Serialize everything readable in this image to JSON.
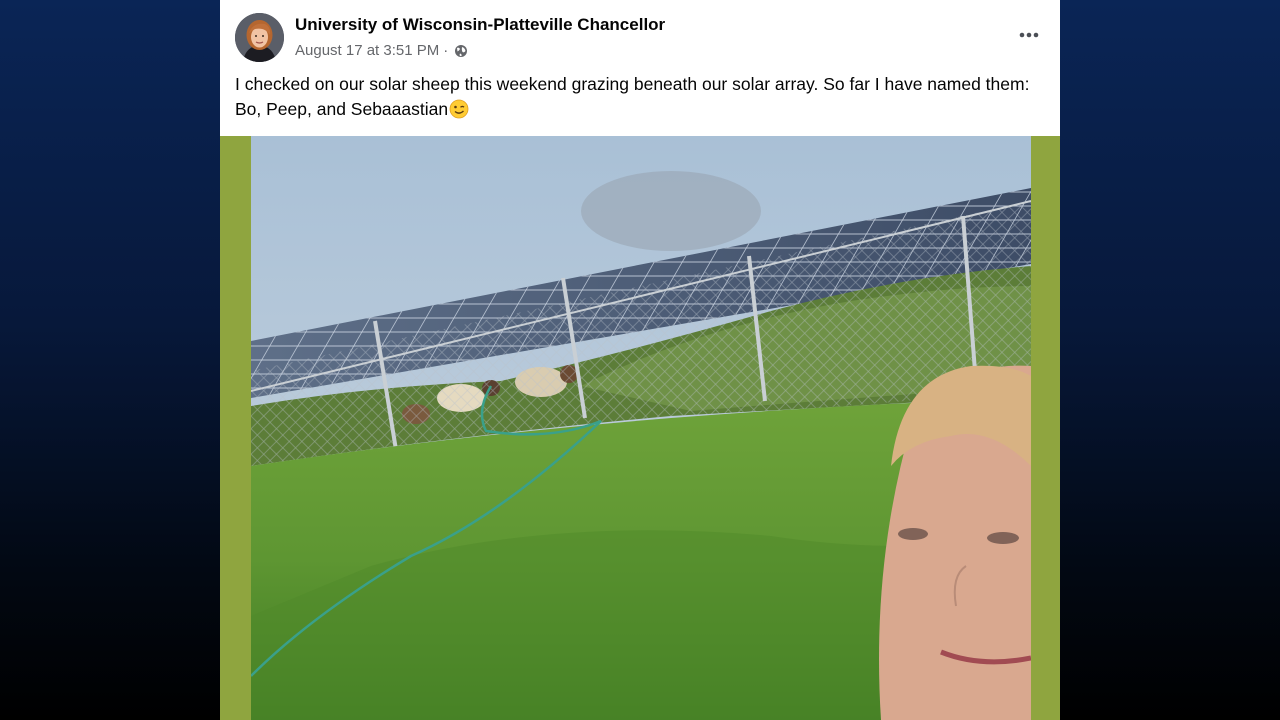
{
  "post": {
    "author": "University of Wisconsin-Platteville Chancellor",
    "timestamp": "August 17 at 3:51 PM",
    "separator": "·",
    "privacy_icon": "globe-icon",
    "more_icon": "more-options-icon",
    "caption": "I checked on our solar sheep this weekend grazing beneath our solar array. So far I have named them: Bo, Peep, and Sebaaastian",
    "caption_emoji": "winking-face-emoji"
  },
  "colors": {
    "page_background": "#0a2556",
    "card": "#ffffff",
    "photo_frame": "#8fa53f",
    "meta_text": "#65676b"
  }
}
